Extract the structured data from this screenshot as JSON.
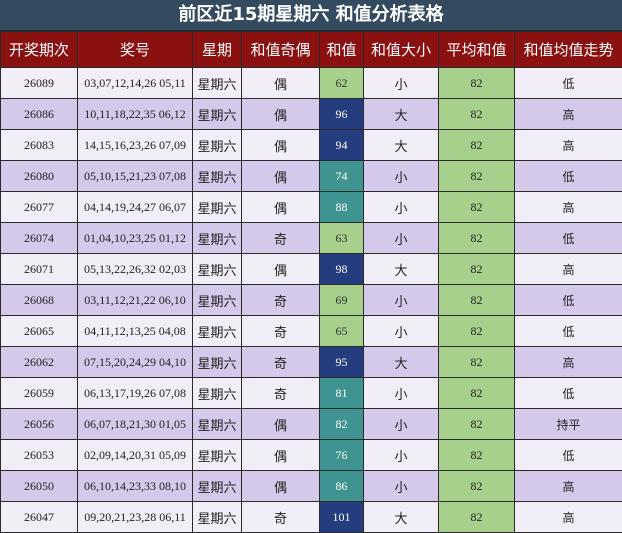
{
  "title": "前区近15期星期六 和值分析表格",
  "headers": [
    "开奖期次",
    "奖号",
    "星期",
    "和值奇偶",
    "和值",
    "和值大小",
    "平均和值",
    "和值均值走势"
  ],
  "colors": {
    "header_bg": "#8b1010",
    "title_bg": "#344a5e",
    "row_light": "#f2eef8",
    "row_dark": "#d4c9ea",
    "avg_green": "#a6d08c",
    "sum_low": "#a6d08c",
    "sum_mid": "#3f9390",
    "sum_high": "#253c7e"
  },
  "rows": [
    {
      "issue": "26089",
      "numbers": "03,07,12,14,26 05,11",
      "weekday": "星期六",
      "parity": "偶",
      "sum": "62",
      "size": "小",
      "avg": "82",
      "trend": "低"
    },
    {
      "issue": "26086",
      "numbers": "10,11,18,22,35 06,12",
      "weekday": "星期六",
      "parity": "偶",
      "sum": "96",
      "size": "大",
      "avg": "82",
      "trend": "高"
    },
    {
      "issue": "26083",
      "numbers": "14,15,16,23,26 07,09",
      "weekday": "星期六",
      "parity": "偶",
      "sum": "94",
      "size": "大",
      "avg": "82",
      "trend": "高"
    },
    {
      "issue": "26080",
      "numbers": "05,10,15,21,23 07,08",
      "weekday": "星期六",
      "parity": "偶",
      "sum": "74",
      "size": "小",
      "avg": "82",
      "trend": "低"
    },
    {
      "issue": "26077",
      "numbers": "04,14,19,24,27 06,07",
      "weekday": "星期六",
      "parity": "偶",
      "sum": "88",
      "size": "小",
      "avg": "82",
      "trend": "高"
    },
    {
      "issue": "26074",
      "numbers": "01,04,10,23,25 01,12",
      "weekday": "星期六",
      "parity": "奇",
      "sum": "63",
      "size": "小",
      "avg": "82",
      "trend": "低"
    },
    {
      "issue": "26071",
      "numbers": "05,13,22,26,32 02,03",
      "weekday": "星期六",
      "parity": "偶",
      "sum": "98",
      "size": "大",
      "avg": "82",
      "trend": "高"
    },
    {
      "issue": "26068",
      "numbers": "03,11,12,21,22 06,10",
      "weekday": "星期六",
      "parity": "奇",
      "sum": "69",
      "size": "小",
      "avg": "82",
      "trend": "低"
    },
    {
      "issue": "26065",
      "numbers": "04,11,12,13,25 04,08",
      "weekday": "星期六",
      "parity": "奇",
      "sum": "65",
      "size": "小",
      "avg": "82",
      "trend": "低"
    },
    {
      "issue": "26062",
      "numbers": "07,15,20,24,29 04,10",
      "weekday": "星期六",
      "parity": "奇",
      "sum": "95",
      "size": "大",
      "avg": "82",
      "trend": "高"
    },
    {
      "issue": "26059",
      "numbers": "06,13,17,19,26 07,08",
      "weekday": "星期六",
      "parity": "奇",
      "sum": "81",
      "size": "小",
      "avg": "82",
      "trend": "低"
    },
    {
      "issue": "26056",
      "numbers": "06,07,18,21,30 01,05",
      "weekday": "星期六",
      "parity": "偶",
      "sum": "82",
      "size": "小",
      "avg": "82",
      "trend": "持平"
    },
    {
      "issue": "26053",
      "numbers": "02,09,14,20,31 05,09",
      "weekday": "星期六",
      "parity": "偶",
      "sum": "76",
      "size": "小",
      "avg": "82",
      "trend": "低"
    },
    {
      "issue": "26050",
      "numbers": "06,10,14,23,33 08,10",
      "weekday": "星期六",
      "parity": "偶",
      "sum": "86",
      "size": "小",
      "avg": "82",
      "trend": "高"
    },
    {
      "issue": "26047",
      "numbers": "09,20,21,23,28 06,11",
      "weekday": "星期六",
      "parity": "奇",
      "sum": "101",
      "size": "大",
      "avg": "82",
      "trend": "高"
    }
  ]
}
